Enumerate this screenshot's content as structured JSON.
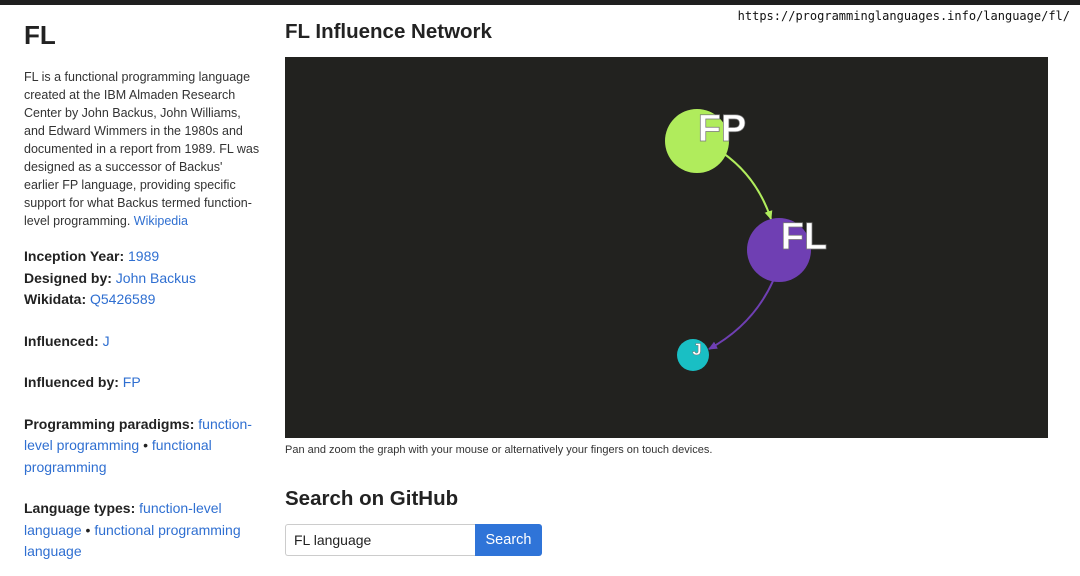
{
  "browser": {
    "url": "https://programminglanguages.info/language/fl/"
  },
  "sidebar": {
    "title": "FL",
    "description": "FL is a functional programming language created at the IBM Almaden Research Center by John Backus, John Williams, and Edward Wimmers in the 1980s and documented in a report from 1989. FL was designed as a successor of Backus' earlier FP language, providing specific support for what Backus termed function-level programming.",
    "wikipedia_link": "Wikipedia",
    "inception_label": "Inception Year:",
    "inception_value": "1989",
    "designed_label": "Designed by:",
    "designed_value": "John Backus",
    "wikidata_label": "Wikidata:",
    "wikidata_value": "Q5426589",
    "influenced_label": "Influenced:",
    "influenced_value": "J",
    "influenced_by_label": "Influenced by:",
    "influenced_by_value": "FP",
    "paradigms_label": "Programming paradigms:",
    "paradigms": [
      "function-level programming",
      "functional programming"
    ],
    "types_label": "Language types:",
    "types": [
      "function-level language",
      "functional programming language"
    ],
    "separator": "•"
  },
  "graph_section": {
    "title": "FL Influence Network",
    "caption": "Pan and zoom the graph with your mouse or alternatively your fingers on touch devices.",
    "background": "#22221f",
    "nodes": [
      {
        "id": "FP",
        "label": "FP",
        "color": "#b0ec5c"
      },
      {
        "id": "FL",
        "label": "FL",
        "color": "#6f3fb3"
      },
      {
        "id": "J",
        "label": "J",
        "color": "#19bfc4"
      }
    ],
    "edges": [
      {
        "from": "FP",
        "to": "FL",
        "color": "#b0ec5c"
      },
      {
        "from": "FL",
        "to": "J",
        "color": "#6f3fb3"
      }
    ]
  },
  "search": {
    "title": "Search on GitHub",
    "input_value": "FL language",
    "button_label": "Search"
  }
}
